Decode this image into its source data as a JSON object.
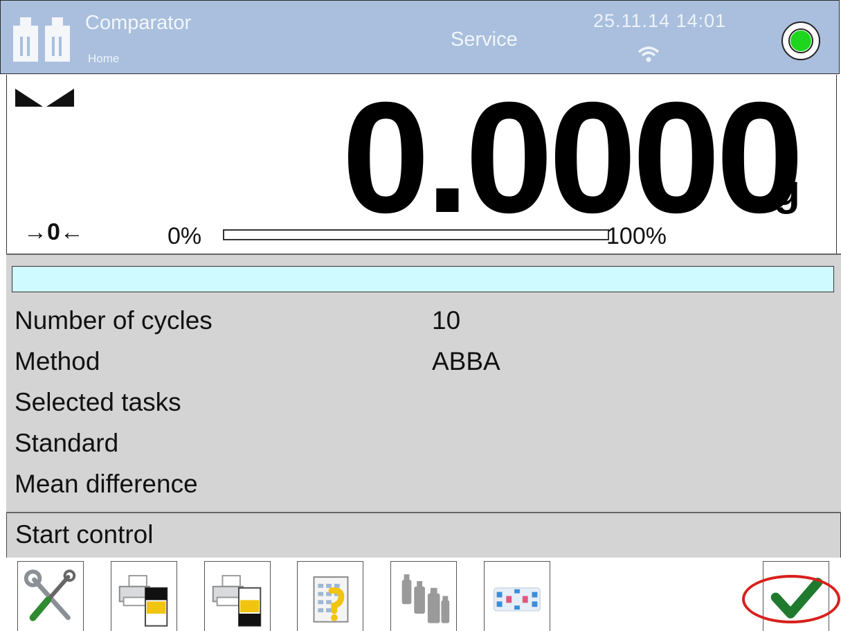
{
  "header": {
    "mode_title": "Comparator",
    "user": "Home",
    "profile": "Service",
    "datetime": "25.11.14 14:01",
    "icons": {
      "app": "comparator-weights-icon",
      "wifi": "wifi-icon",
      "status": "status-led-icon"
    },
    "status_color": "#1fd61f"
  },
  "weighing": {
    "value": "0.0000",
    "unit": "g",
    "zero_indicator": "→0←",
    "bargraph_min": "0%",
    "bargraph_max": "100%",
    "bargraph_level": 0,
    "stability_icon": "stability-marker-icon"
  },
  "info": {
    "rows": [
      {
        "label": "Number of cycles",
        "value": "10"
      },
      {
        "label": "Method",
        "value": "ABBA"
      },
      {
        "label": "Selected tasks",
        "value": ""
      },
      {
        "label": "Standard",
        "value": ""
      },
      {
        "label": "Mean difference",
        "value": ""
      }
    ],
    "bar_color": "#cffaff"
  },
  "start_control": {
    "label": "Start control"
  },
  "toolbar": {
    "buttons": [
      {
        "icon": "settings-tools-icon"
      },
      {
        "icon": "printer-header-icon"
      },
      {
        "icon": "printer-footer-icon"
      },
      {
        "icon": "task-select-icon"
      },
      {
        "icon": "weights-icon"
      },
      {
        "icon": "cycle-matrix-icon"
      },
      {
        "icon": "confirm-check-icon"
      }
    ]
  },
  "colors": {
    "header_bg": "#a9bfdd",
    "panel_bg": "#d4d4d4",
    "accent_green": "#1f7a2e",
    "highlight_red": "#d8201c"
  }
}
